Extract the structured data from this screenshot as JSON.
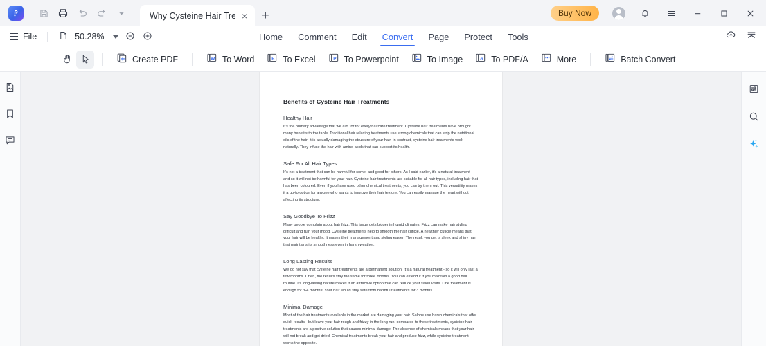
{
  "titlebar": {
    "logo_text": "P",
    "icons": [
      {
        "name": "save-icon",
        "enabled": false
      },
      {
        "name": "print-icon",
        "enabled": true
      },
      {
        "name": "undo-icon",
        "enabled": false
      },
      {
        "name": "redo-icon",
        "enabled": false
      },
      {
        "name": "chevron-down-icon",
        "enabled": false
      }
    ],
    "tab_title": "Why Cysteine Hair Treat...",
    "tab_close": "×",
    "new_tab": "+",
    "buy_now": "Buy Now",
    "minimize": "─",
    "maximize": "□",
    "close": "×"
  },
  "menubar": {
    "file_label": "File",
    "zoom_percent": "50.28%",
    "ribbon_tabs": [
      {
        "label": "Home",
        "active": false
      },
      {
        "label": "Comment",
        "active": false
      },
      {
        "label": "Edit",
        "active": false
      },
      {
        "label": "Convert",
        "active": true
      },
      {
        "label": "Page",
        "active": false
      },
      {
        "label": "Protect",
        "active": false
      },
      {
        "label": "Tools",
        "active": false
      }
    ]
  },
  "toolbar": {
    "hand_tool": "hand-tool",
    "select_tool": "select-tool",
    "buttons": [
      {
        "label": "Create PDF",
        "icon": "create-pdf-icon",
        "glyph": "+"
      },
      {
        "label": "To Word",
        "icon": "to-word-icon",
        "glyph": "W"
      },
      {
        "label": "To Excel",
        "icon": "to-excel-icon",
        "glyph": "E"
      },
      {
        "label": "To Powerpoint",
        "icon": "to-powerpoint-icon",
        "glyph": "P"
      },
      {
        "label": "To Image",
        "icon": "to-image-icon",
        "glyph": ""
      },
      {
        "label": "To PDF/A",
        "icon": "to-pdfa-icon",
        "glyph": "A"
      },
      {
        "label": "More",
        "icon": "more-icon",
        "glyph": "···"
      },
      {
        "label": "Batch Convert",
        "icon": "batch-convert-icon",
        "glyph": "⇄"
      }
    ]
  },
  "left_rail": [
    {
      "name": "thumbnails-icon"
    },
    {
      "name": "bookmarks-icon"
    },
    {
      "name": "comments-icon"
    }
  ],
  "right_rail": [
    {
      "name": "form-properties-icon"
    },
    {
      "name": "search-icon"
    },
    {
      "name": "ai-sparkle-icon"
    }
  ],
  "colors": {
    "accent": "#3a6df0",
    "buy_now_start": "#ffd08a",
    "buy_now_end": "#ffb347",
    "viewer_bg": "#f1f2f4",
    "ai_sparkle": "#29a6f0"
  },
  "document": {
    "title": "Benefits of Cysteine Hair Treatments",
    "sections": [
      {
        "heading": "Healthy Hair",
        "body": "It's the primary advantage that we aim for for every haircare treatment. Cysteine hair treatments have brought many benefits to the table. Traditional hair relaxing treatments use strong chemicals that can strip the nutritional oils of the hair. It is actually damaging the structure of your hair. In contrast, cysteine hair treatments work naturally. They infuse the hair with amino acids that can support its health."
      },
      {
        "heading": "Safe For All Hair Types",
        "body": "It's not a treatment that can be harmful for some, and good for others. As I said earlier, it's a natural treatment - and so it will not be harmful for your hair. Cysteine hair treatments are suitable for all hair types, including hair that has been coloured. Even if you have used other chemical treatments, you can try them out. This versatility makes it a go-to option for anyone who wants to improve their hair texture. You can easily manage the heart without affecting its structure."
      },
      {
        "heading": "Say Goodbye To Frizz",
        "body": "Many people complain about hair frizz. This issue gets bigger in humid climates. Frizz can make hair styling difficult and ruin your mood. Cysteine treatments help to smooth the hair cuticle. A healthier cuticle means that your hair will be healthy. It makes their management and styling easier. The result you get is sleek and shiny hair that maintains its smoothness even in harsh weather."
      },
      {
        "heading": "Long Lasting Results",
        "body": "We do not say that cysteine hair treatments are a permanent solution. It's a natural treatment - so it will only last a few months. Often, the results stay the same for three months. You can extend it if you maintain a good hair routine. Its long-lasting nature makes it an attractive option that can reduce your salon visits. One treatment is enough for 3-4 months! Your hair would stay safe from harmful treatments for 3 months."
      },
      {
        "heading": "Minimal Damage",
        "body": "Most of the hair treatments available in the market are damaging your hair. Salons use harsh chemicals that offer quick results - but leave your hair rough and frizzy in the long run; compared to these treatments, cysteine hair treatments are a positive solution that causes minimal damage. The absence of chemicals means that your hair will not break and get dried. Chemical treatments break your hair and produce frizz, while cysteine treatment works the opposite."
      }
    ]
  }
}
